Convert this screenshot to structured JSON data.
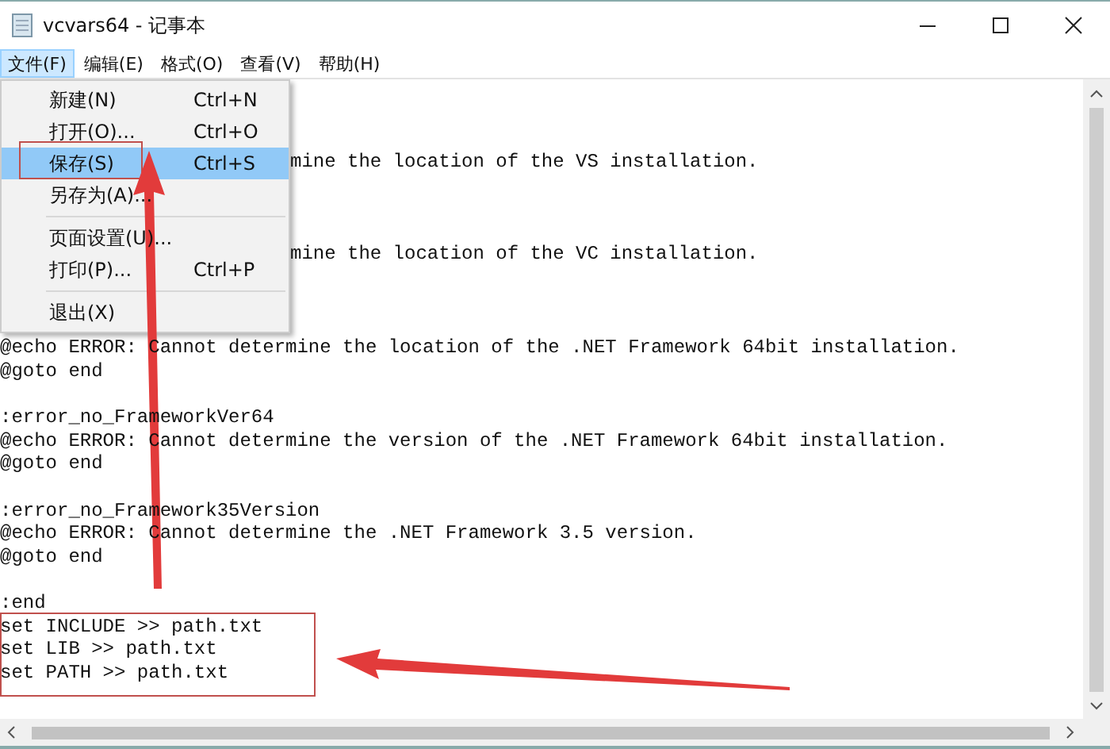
{
  "window": {
    "title": "vcvars64 - 记事本"
  },
  "menubar": [
    {
      "label": "文件(F)",
      "selected": true
    },
    {
      "label": "编辑(E)",
      "selected": false
    },
    {
      "label": "格式(O)",
      "selected": false
    },
    {
      "label": "查看(V)",
      "selected": false
    },
    {
      "label": "帮助(H)",
      "selected": false
    }
  ],
  "file_menu": [
    {
      "kind": "item",
      "label": "新建(N)",
      "shortcut": "Ctrl+N",
      "selected": false
    },
    {
      "kind": "item",
      "label": "打开(O)...",
      "shortcut": "Ctrl+O",
      "selected": false
    },
    {
      "kind": "item",
      "label": "保存(S)",
      "shortcut": "Ctrl+S",
      "selected": true
    },
    {
      "kind": "item",
      "label": "另存为(A)...",
      "selected": false
    },
    {
      "kind": "separator"
    },
    {
      "kind": "item",
      "label": "页面设置(U)...",
      "selected": false
    },
    {
      "kind": "item",
      "label": "打印(P)...",
      "shortcut": "Ctrl+P",
      "selected": false
    },
    {
      "kind": "separator"
    },
    {
      "kind": "item",
      "label": "退出(X)",
      "selected": false
    }
  ],
  "editor_lines": [
    {
      "kind": "blank"
    },
    {
      "kind": "blank"
    },
    {
      "kind": "blank"
    },
    {
      "kind": "partial",
      "text": "mine the location of the VS installation."
    },
    {
      "kind": "blank"
    },
    {
      "kind": "blank"
    },
    {
      "kind": "blank"
    },
    {
      "kind": "partial",
      "text": "mine the location of the VC installation."
    },
    {
      "kind": "blank"
    },
    {
      "kind": "blank"
    },
    {
      "kind": "blank"
    },
    {
      "kind": "full",
      "text": "@echo ERROR: Cannot determine the location of the .NET Framework 64bit installation."
    },
    {
      "kind": "full",
      "text": "@goto end"
    },
    {
      "kind": "blank"
    },
    {
      "kind": "full",
      "text": ":error_no_FrameworkVer64"
    },
    {
      "kind": "full",
      "text": "@echo ERROR: Cannot determine the version of the .NET Framework 64bit installation."
    },
    {
      "kind": "full",
      "text": "@goto end"
    },
    {
      "kind": "blank"
    },
    {
      "kind": "full",
      "text": ":error_no_Framework35Version"
    },
    {
      "kind": "full",
      "text": "@echo ERROR: Cannot determine the .NET Framework 3.5 version."
    },
    {
      "kind": "full",
      "text": "@goto end"
    },
    {
      "kind": "blank"
    },
    {
      "kind": "full",
      "text": ":end"
    },
    {
      "kind": "full",
      "text": "set INCLUDE >> path.txt"
    },
    {
      "kind": "full",
      "text": "set LIB >> path.txt"
    },
    {
      "kind": "full",
      "text": "set PATH >> path.txt"
    }
  ]
}
